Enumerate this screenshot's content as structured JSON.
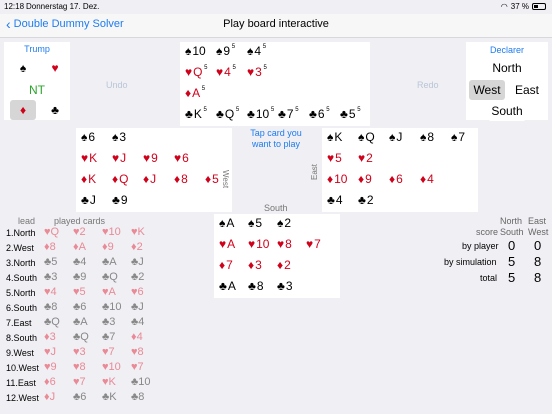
{
  "status": {
    "time": "12:18",
    "date": "Donnerstag 17. Dez.",
    "battery": "37 %"
  },
  "nav": {
    "back_label": "Double Dummy Solver",
    "title": "Play board interactive"
  },
  "trump": {
    "label": "Trump",
    "options": [
      "♠",
      "♥",
      "NT",
      "♦",
      "♣"
    ],
    "selected": "♦"
  },
  "controls": {
    "undo": "Undo",
    "redo": "Redo",
    "hint": "Tap card you want to play"
  },
  "declarer": {
    "label": "Declarer",
    "options": [
      "North",
      "West",
      "East",
      "South"
    ],
    "selected": "West"
  },
  "hands": {
    "north": [
      [
        {
          "s": "♠",
          "r": "10",
          "c": "blk"
        },
        {
          "s": "♠",
          "r": "9",
          "c": "blk",
          "sup": "5"
        },
        {
          "s": "♠",
          "r": "4",
          "c": "blk",
          "sup": "5"
        }
      ],
      [
        {
          "s": "♥",
          "r": "Q",
          "c": "red",
          "sup": "5"
        },
        {
          "s": "♥",
          "r": "4",
          "c": "red",
          "sup": "5"
        },
        {
          "s": "♥",
          "r": "3",
          "c": "red",
          "sup": "5"
        }
      ],
      [
        {
          "s": "♦",
          "r": "A",
          "c": "red",
          "sup": "5"
        }
      ],
      [
        {
          "s": "♣",
          "r": "K",
          "c": "blk",
          "sup": "5"
        },
        {
          "s": "♣",
          "r": "Q",
          "c": "blk",
          "sup": "5"
        },
        {
          "s": "♣",
          "r": "10",
          "c": "blk",
          "sup": "5"
        },
        {
          "s": "♣",
          "r": "7",
          "c": "blk",
          "sup": "5"
        },
        {
          "s": "♣",
          "r": "6",
          "c": "blk",
          "sup": "5"
        },
        {
          "s": "♣",
          "r": "5",
          "c": "blk",
          "sup": "5"
        }
      ]
    ],
    "west": [
      [
        {
          "s": "♠",
          "r": "6",
          "c": "blk"
        },
        {
          "s": "♠",
          "r": "3",
          "c": "blk"
        }
      ],
      [
        {
          "s": "♥",
          "r": "K",
          "c": "red"
        },
        {
          "s": "♥",
          "r": "J",
          "c": "red"
        },
        {
          "s": "♥",
          "r": "9",
          "c": "red"
        },
        {
          "s": "♥",
          "r": "6",
          "c": "red"
        }
      ],
      [
        {
          "s": "♦",
          "r": "K",
          "c": "red"
        },
        {
          "s": "♦",
          "r": "Q",
          "c": "red"
        },
        {
          "s": "♦",
          "r": "J",
          "c": "red"
        },
        {
          "s": "♦",
          "r": "8",
          "c": "red"
        },
        {
          "s": "♦",
          "r": "5",
          "c": "red"
        }
      ],
      [
        {
          "s": "♣",
          "r": "J",
          "c": "blk"
        },
        {
          "s": "♣",
          "r": "9",
          "c": "blk"
        }
      ]
    ],
    "east": [
      [
        {
          "s": "♠",
          "r": "K",
          "c": "blk"
        },
        {
          "s": "♠",
          "r": "Q",
          "c": "blk"
        },
        {
          "s": "♠",
          "r": "J",
          "c": "blk"
        },
        {
          "s": "♠",
          "r": "8",
          "c": "blk"
        },
        {
          "s": "♠",
          "r": "7",
          "c": "blk"
        }
      ],
      [
        {
          "s": "♥",
          "r": "5",
          "c": "red"
        },
        {
          "s": "♥",
          "r": "2",
          "c": "red"
        }
      ],
      [
        {
          "s": "♦",
          "r": "10",
          "c": "red"
        },
        {
          "s": "♦",
          "r": "9",
          "c": "red"
        },
        {
          "s": "♦",
          "r": "6",
          "c": "red"
        },
        {
          "s": "♦",
          "r": "4",
          "c": "red"
        }
      ],
      [
        {
          "s": "♣",
          "r": "4",
          "c": "blk"
        },
        {
          "s": "♣",
          "r": "2",
          "c": "blk"
        }
      ]
    ],
    "south": [
      [
        {
          "s": "♠",
          "r": "A",
          "c": "blk"
        },
        {
          "s": "♠",
          "r": "5",
          "c": "blk"
        },
        {
          "s": "♠",
          "r": "2",
          "c": "blk"
        }
      ],
      [
        {
          "s": "♥",
          "r": "A",
          "c": "red"
        },
        {
          "s": "♥",
          "r": "10",
          "c": "red"
        },
        {
          "s": "♥",
          "r": "8",
          "c": "red"
        },
        {
          "s": "♥",
          "r": "7",
          "c": "red"
        }
      ],
      [
        {
          "s": "♦",
          "r": "7",
          "c": "red"
        },
        {
          "s": "♦",
          "r": "3",
          "c": "red"
        },
        {
          "s": "♦",
          "r": "2",
          "c": "red"
        }
      ],
      [
        {
          "s": "♣",
          "r": "A",
          "c": "blk"
        },
        {
          "s": "♣",
          "r": "8",
          "c": "blk"
        },
        {
          "s": "♣",
          "r": "3",
          "c": "blk"
        }
      ]
    ]
  },
  "seat_labels": {
    "west": "West",
    "east": "East",
    "south": "South"
  },
  "tricks": {
    "header_lead": "lead",
    "header_played": "played cards",
    "rows": [
      {
        "lead": "1.North",
        "cards": [
          [
            "♥",
            "Q",
            "pink"
          ],
          [
            "♥",
            "2",
            "pink"
          ],
          [
            "♥",
            "10",
            "pink"
          ],
          [
            "♥",
            "K",
            "pink"
          ]
        ]
      },
      {
        "lead": "2.West",
        "cards": [
          [
            "♦",
            "8",
            "pink"
          ],
          [
            "♦",
            "A",
            "pink"
          ],
          [
            "♦",
            "9",
            "pink"
          ],
          [
            "♦",
            "2",
            "pink"
          ]
        ]
      },
      {
        "lead": "3.North",
        "cards": [
          [
            "♣",
            "5",
            "grayc"
          ],
          [
            "♣",
            "4",
            "grayc"
          ],
          [
            "♣",
            "A",
            "grayc"
          ],
          [
            "♣",
            "J",
            "grayc"
          ]
        ]
      },
      {
        "lead": "4.South",
        "cards": [
          [
            "♣",
            "3",
            "grayc"
          ],
          [
            "♣",
            "9",
            "grayc"
          ],
          [
            "♣",
            "Q",
            "grayc"
          ],
          [
            "♣",
            "2",
            "grayc"
          ]
        ]
      },
      {
        "lead": "5.North",
        "cards": [
          [
            "♥",
            "4",
            "pink"
          ],
          [
            "♥",
            "5",
            "pink"
          ],
          [
            "♥",
            "A",
            "pink"
          ],
          [
            "♥",
            "6",
            "pink"
          ]
        ]
      },
      {
        "lead": "6.South",
        "cards": [
          [
            "♣",
            "8",
            "grayc"
          ],
          [
            "♣",
            "6",
            "grayc"
          ],
          [
            "♣",
            "10",
            "grayc"
          ],
          [
            "♣",
            "J",
            "grayc"
          ]
        ]
      },
      {
        "lead": "7.East",
        "cards": [
          [
            "♣",
            "Q",
            "grayc"
          ],
          [
            "♣",
            "A",
            "grayc"
          ],
          [
            "♣",
            "3",
            "grayc"
          ],
          [
            "♣",
            "4",
            "grayc"
          ]
        ]
      },
      {
        "lead": "8.South",
        "cards": [
          [
            "♦",
            "3",
            "pink"
          ],
          [
            "♣",
            "Q",
            "grayc"
          ],
          [
            "♣",
            "7",
            "grayc"
          ],
          [
            "♦",
            "4",
            "pink"
          ]
        ]
      },
      {
        "lead": "9.West",
        "cards": [
          [
            "♥",
            "J",
            "pink"
          ],
          [
            "♥",
            "3",
            "pink"
          ],
          [
            "♥",
            "7",
            "pink"
          ],
          [
            "♥",
            "8",
            "pink"
          ]
        ]
      },
      {
        "lead": "10.West",
        "cards": [
          [
            "♥",
            "9",
            "pink"
          ],
          [
            "♥",
            "8",
            "pink"
          ],
          [
            "♥",
            "10",
            "pink"
          ],
          [
            "♥",
            "7",
            "pink"
          ]
        ]
      },
      {
        "lead": "11.East",
        "cards": [
          [
            "♦",
            "6",
            "pink"
          ],
          [
            "♥",
            "7",
            "pink"
          ],
          [
            "♥",
            "K",
            "pink"
          ],
          [
            "♣",
            "10",
            "grayc"
          ]
        ]
      },
      {
        "lead": "12.West",
        "cards": [
          [
            "♦",
            "J",
            "pink"
          ],
          [
            "♣",
            "6",
            "grayc"
          ],
          [
            "♣",
            "K",
            "grayc"
          ],
          [
            "♣",
            "8",
            "grayc"
          ]
        ]
      }
    ]
  },
  "score": {
    "col1": [
      "North",
      "South"
    ],
    "col2": [
      "East",
      "West"
    ],
    "score_label": "score",
    "rows": [
      {
        "label": "by player",
        "ns": "0",
        "ew": "0"
      },
      {
        "label": "by simulation",
        "ns": "5",
        "ew": "8"
      },
      {
        "label": "total",
        "ns": "5",
        "ew": "8"
      }
    ]
  }
}
